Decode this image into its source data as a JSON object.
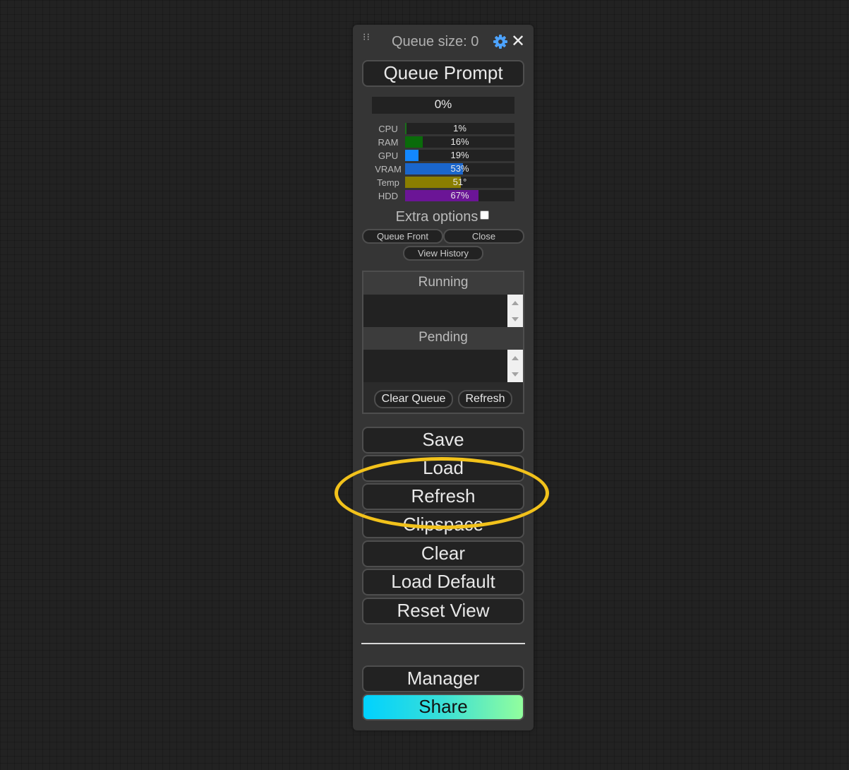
{
  "header": {
    "queue_size": "Queue size: 0",
    "settings_icon": "gear-icon",
    "close_icon": "close-icon"
  },
  "queue_prompt": "Queue Prompt",
  "progress": {
    "text": "0%",
    "value": 0
  },
  "stats": [
    {
      "label": "CPU",
      "value": "1%",
      "fraction": 0.01,
      "color": "#1a6f1a"
    },
    {
      "label": "RAM",
      "value": "16%",
      "fraction": 0.16,
      "color": "#0a6b0a"
    },
    {
      "label": "GPU",
      "value": "19%",
      "fraction": 0.12,
      "color": "#1388ff"
    },
    {
      "label": "VRAM",
      "value": "53%",
      "fraction": 0.53,
      "color": "#1a66cc"
    },
    {
      "label": "Temp",
      "value": "51°",
      "fraction": 0.51,
      "color": "#8a7e00"
    },
    {
      "label": "HDD",
      "value": "67%",
      "fraction": 0.67,
      "color": "#6b1596"
    }
  ],
  "extra_options": {
    "label": "Extra options",
    "checked": false
  },
  "queue_front": "Queue Front",
  "close": "Close",
  "view_history": "View History",
  "queue": {
    "running": "Running",
    "pending": "Pending",
    "clear_queue": "Clear Queue",
    "refresh": "Refresh"
  },
  "buttons": {
    "save": "Save",
    "load": "Load",
    "refresh": "Refresh",
    "clipspace": "Clipspace",
    "clear": "Clear",
    "load_default": "Load Default",
    "reset_view": "Reset View",
    "manager": "Manager",
    "share": "Share"
  },
  "colors": {
    "highlight": "#f2c21b",
    "share_gradient_start": "#00d2ff",
    "share_gradient_end": "#92fe9d"
  }
}
